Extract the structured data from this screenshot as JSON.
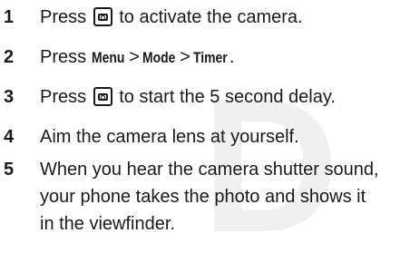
{
  "watermark": "D",
  "steps": [
    {
      "number": "1",
      "before": "Press",
      "icon": "camera-key-icon",
      "after": "to activate the camera."
    },
    {
      "number": "2",
      "before": "Press",
      "menu_path": [
        "Menu",
        "Mode",
        "Timer"
      ],
      "separator": ">",
      "after": "."
    },
    {
      "number": "3",
      "before": "Press",
      "icon": "camera-key-icon",
      "after": "to start the 5 second delay."
    },
    {
      "number": "4",
      "text": "Aim the camera lens at yourself."
    },
    {
      "number": "5",
      "lines": [
        "When you hear the camera shutter sound,",
        "your phone takes the photo and shows it",
        "in the viewfinder."
      ]
    }
  ]
}
